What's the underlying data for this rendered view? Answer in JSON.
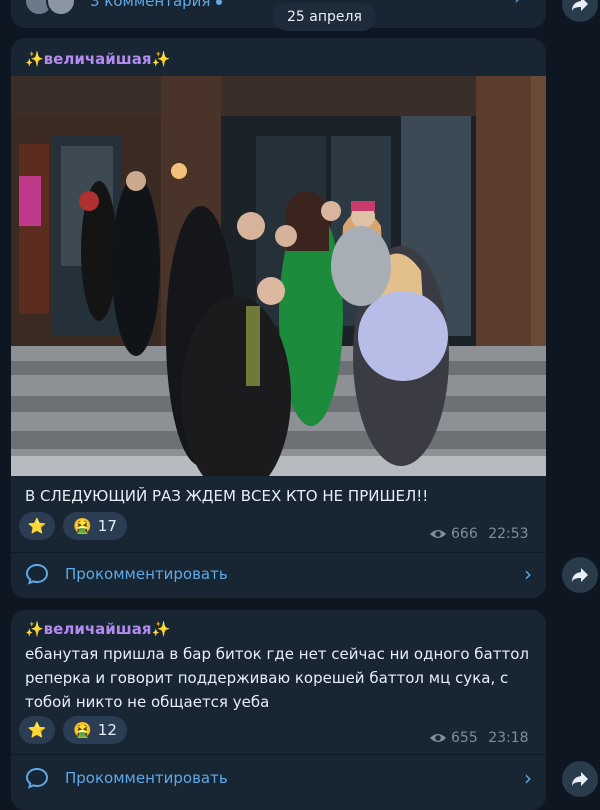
{
  "top": {
    "comments_label": "3 комментария",
    "date": "25 апреля"
  },
  "post1": {
    "sender": "✨величайшая✨",
    "caption": "В СЛЕДУЮЩИЙ РАЗ ЖДЕМ ВСЕХ КТО НЕ ПРИШЕЛ!!",
    "reactions": [
      {
        "emoji": "⭐",
        "count": ""
      },
      {
        "emoji": "🤮",
        "count": "17"
      }
    ],
    "views": "666",
    "time": "22:53",
    "comment_label": "Прокомментировать"
  },
  "post2": {
    "sender": "✨величайшая✨",
    "text": "ебанутая пришла в бар биток где нет сейчас ни одного баттол реперка и говорит поддерживаю корешей баттол мц сука, с тобой никто не общается уеба",
    "reactions": [
      {
        "emoji": "⭐",
        "count": ""
      },
      {
        "emoji": "🤮",
        "count": "12"
      }
    ],
    "views": "655",
    "time": "23:18",
    "comment_label": "Прокомментировать"
  },
  "icons": {
    "share": "share-arrow-icon",
    "eye": "eye-icon",
    "comment": "comment-bubble-icon",
    "chevron": "chevron-right-icon"
  },
  "colors": {
    "background": "#0e1621",
    "bubble": "#182533",
    "accent": "#5fa9e8",
    "sender": "#b48cf0",
    "meta": "#7f8e9c"
  }
}
